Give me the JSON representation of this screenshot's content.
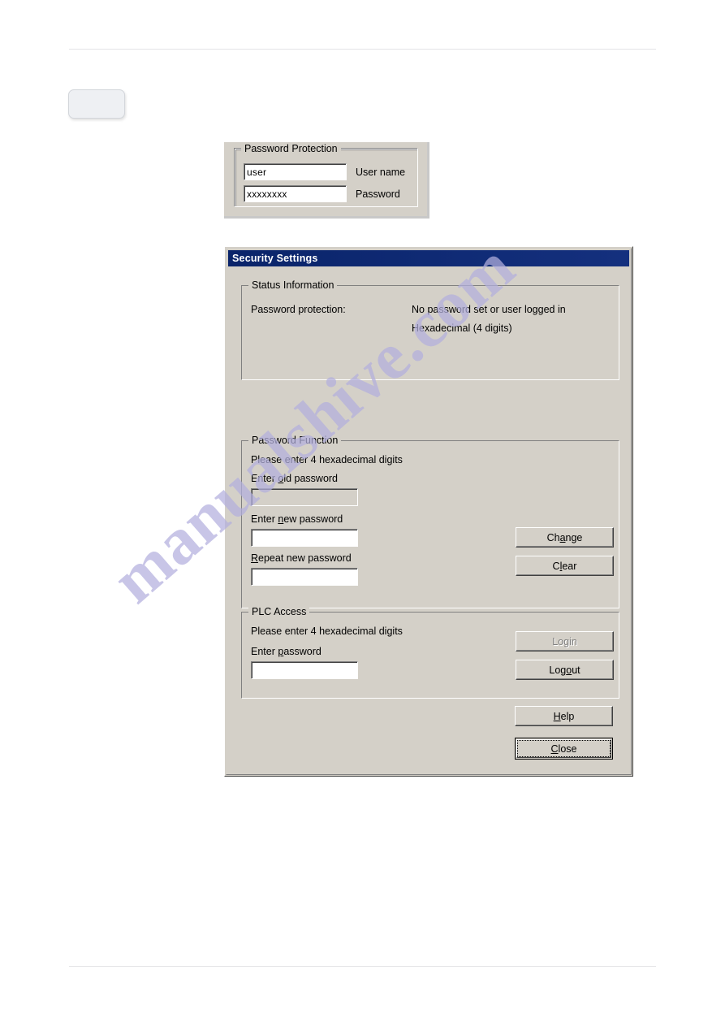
{
  "figure_password_protection": {
    "group_legend": "Password Protection",
    "rows": [
      {
        "value": "user",
        "label": "User name"
      },
      {
        "value": "xxxxxxxx",
        "label": "Password"
      }
    ]
  },
  "dialog": {
    "title": "Security Settings",
    "status_group": {
      "legend": "Status Information",
      "label": "Password protection:",
      "value_line1": "No password set or user logged in",
      "value_line2": "Hexadecimal (4 digits)"
    },
    "password_function_group": {
      "legend": "Password Function",
      "hint": "Please enter 4 hexadecimal digits",
      "fields": [
        {
          "label_pre": "Enter ",
          "label_accel": "o",
          "label_post": "ld password",
          "value": "",
          "disabled": true
        },
        {
          "label_pre": "Enter ",
          "label_accel": "n",
          "label_post": "ew password",
          "value": "",
          "disabled": false
        },
        {
          "label_pre": "",
          "label_accel": "R",
          "label_post": "epeat new password",
          "value": "",
          "disabled": false
        }
      ],
      "buttons": [
        {
          "pre": "Ch",
          "accel": "a",
          "post": "nge",
          "disabled": false
        },
        {
          "pre": "C",
          "accel": "l",
          "post": "ear",
          "disabled": false
        }
      ]
    },
    "plc_access_group": {
      "legend": "PLC Access",
      "hint": "Please enter 4 hexadecimal digits",
      "field": {
        "label_pre": "Enter ",
        "label_accel": "p",
        "label_post": "assword",
        "value": "",
        "disabled": false
      },
      "buttons": [
        {
          "pre": "Lo",
          "accel": "g",
          "post": "in",
          "disabled": true
        },
        {
          "pre": "Log",
          "accel": "o",
          "post": "ut",
          "disabled": false
        }
      ]
    },
    "footer_buttons": [
      {
        "pre": "",
        "accel": "H",
        "post": "elp",
        "focused": false
      },
      {
        "pre": "",
        "accel": "C",
        "post": "lose",
        "focused": true
      }
    ]
  },
  "watermark": {
    "text": "manualshive.com",
    "color": "#b3b0de"
  },
  "colors": {
    "dialog_face": "#d4d0c8",
    "titlebar": "#0a246a",
    "field_background": "#ffffff",
    "field_disabled": "#d4d0c8",
    "text": "#000000",
    "disabled_text": "#808080"
  }
}
